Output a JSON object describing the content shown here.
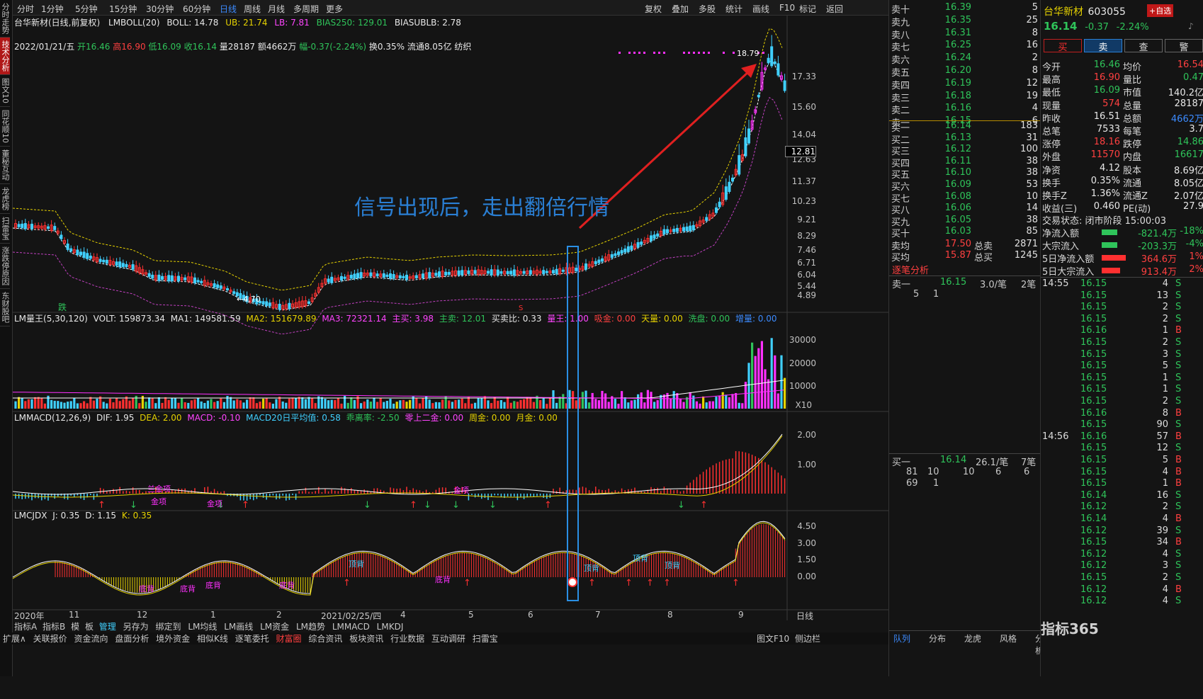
{
  "left_tabs": [
    "分时走势",
    "技术分析",
    "图文10",
    "同花顺10",
    "董秘互动",
    "龙虎榜",
    "扫雷宝",
    "涨跌停原因",
    "东财股吧"
  ],
  "toolbar": {
    "items": [
      "分时",
      "1分钟",
      "5分钟",
      "15分钟",
      "30分钟",
      "60分钟",
      "日线",
      "周线",
      "月线",
      "多周期",
      "更多"
    ],
    "active": "日线",
    "right_items": [
      "复权",
      "叠加",
      "多股",
      "统计",
      "画线",
      "F10",
      "标记",
      "返回"
    ]
  },
  "title": {
    "name": "台华新材(日线,前复权)",
    "indicator": "LMBOLL(20)",
    "boll": "BOLL: 14.78",
    "ub": "UB: 21.74",
    "lb": "LB: 7.81",
    "bias": "BIAS250: 129.01",
    "biasub": "BIASUBLB: 2.78"
  },
  "info": {
    "date": "2022/01/21/五",
    "open": "开16.46",
    "high": "高16.90",
    "low": "低16.09",
    "close": "收16.14",
    "vol": "量28187",
    "amt": "额4662万",
    "chg": "幅-0.37(-2.24%)",
    "turn": "换0.35%",
    "float": "流通8.05亿",
    "sector": "纺织"
  },
  "price_axis": [
    "17.33",
    "15.60",
    "14.04",
    "12.63",
    "11.37",
    "10.23",
    "9.21",
    "8.29",
    "7.46",
    "6.71",
    "6.04",
    "5.44",
    "4.89"
  ],
  "price_current": "12.81",
  "price_marks": {
    "high": "18.79",
    "low": "4.70"
  },
  "annotation": "信号出现后，走出翻倍行情",
  "signal_labels": {
    "fall": "跌",
    "s": "S"
  },
  "vol_header": {
    "name": "LM量王(5,30,120)",
    "volt": "VOLT: 159873.34",
    "ma1": "MA1: 149581.59",
    "ma2": "MA2: 151679.89",
    "ma3": "MA3: 72321.14",
    "buy": "主买: 3.98",
    "sell": "主卖: 12.01",
    "ratio": "买卖比: 0.33",
    "king": "量王: 1.00",
    "absorb": "吸金: 0.00",
    "sky": "天量: 0.00",
    "wash": "洗盘: 0.00",
    "extra": "增量: 0.00"
  },
  "vol_axis": [
    "30000",
    "20000",
    "10000"
  ],
  "vol_unit": "X10",
  "macd_header": {
    "name": "LMMACD(12,26,9)",
    "dif": "DIF: 1.95",
    "dea": "DEA: 2.00",
    "macd": "MACD: -0.10",
    "avg": "MACD20日平均值: 0.58",
    "dist": "乖离率: -2.50",
    "zero": "零上二金: 0.00",
    "week": "周金: 0.00",
    "month": "月金: 0.00"
  },
  "macd_axis": [
    "2.00",
    "1.00"
  ],
  "macd_labels": [
    "兰金项",
    "金项",
    "金项",
    "金项"
  ],
  "kdj_header": {
    "name": "LMCJDX",
    "j": "J: 0.35",
    "d": "D: 1.15",
    "k": "K: 0.35"
  },
  "kdj_axis": [
    "4.50",
    "3.00",
    "1.50",
    "0.00"
  ],
  "kdj_labels": [
    "顶背",
    "底背",
    "底背",
    "底背",
    "底背",
    "底背",
    "顶背",
    "顶背",
    "顶背"
  ],
  "date_axis": {
    "items": [
      "2020年",
      "11",
      "12",
      "1",
      "2",
      "2021/02/25/四",
      "4",
      "5",
      "6",
      "7",
      "8",
      "9"
    ],
    "right": "日线"
  },
  "bottom1": [
    "指标A",
    "指标B",
    "模",
    "板",
    "管理",
    "另存为",
    "绑定到",
    "LM均线",
    "LM画线",
    "LM资金",
    "LM趋势",
    "LMMACD",
    "LMKDJ"
  ],
  "bottom2": [
    "扩展∧",
    "关联报价",
    "资金流向",
    "盘面分析",
    "境外资金",
    "相似K线",
    "逐笔委托",
    "财富圈",
    "综合资讯",
    "板块资讯",
    "行业数据",
    "互动调研",
    "扫雷宝"
  ],
  "bottom2_right": [
    "图文F10",
    "侧边栏"
  ],
  "orderbook": {
    "asks": [
      {
        "label": "卖十",
        "price": "16.39",
        "vol": "5"
      },
      {
        "label": "卖九",
        "price": "16.35",
        "vol": "25"
      },
      {
        "label": "卖八",
        "price": "16.31",
        "vol": "8"
      },
      {
        "label": "卖七",
        "price": "16.25",
        "vol": "16"
      },
      {
        "label": "卖六",
        "price": "16.24",
        "vol": "2"
      },
      {
        "label": "卖五",
        "price": "16.20",
        "vol": "8"
      },
      {
        "label": "卖四",
        "price": "16.19",
        "vol": "12"
      },
      {
        "label": "卖三",
        "price": "16.18",
        "vol": "19"
      },
      {
        "label": "卖二",
        "price": "16.16",
        "vol": "4"
      },
      {
        "label": "卖一",
        "price": "16.15",
        "vol": "6"
      }
    ],
    "bids": [
      {
        "label": "买一",
        "price": "16.14",
        "vol": "183"
      },
      {
        "label": "买二",
        "price": "16.13",
        "vol": "31"
      },
      {
        "label": "买三",
        "price": "16.12",
        "vol": "100"
      },
      {
        "label": "买四",
        "price": "16.11",
        "vol": "38"
      },
      {
        "label": "买五",
        "price": "16.10",
        "vol": "38"
      },
      {
        "label": "买六",
        "price": "16.09",
        "vol": "53"
      },
      {
        "label": "买七",
        "price": "16.08",
        "vol": "10"
      },
      {
        "label": "买八",
        "price": "16.06",
        "vol": "14"
      },
      {
        "label": "买九",
        "price": "16.05",
        "vol": "38"
      },
      {
        "label": "买十",
        "price": "16.03",
        "vol": "85"
      }
    ],
    "avg_sell": {
      "label": "卖均",
      "price": "17.50",
      "k": "总卖",
      "v": "2871"
    },
    "avg_buy": {
      "label": "买均",
      "price": "15.87",
      "k": "总买",
      "v": "1245"
    },
    "section": "逐笔分析",
    "sell1": {
      "label": "卖一",
      "price": "16.15",
      "per": "3.0/笔",
      "count": "2笔",
      "d1": "5",
      "d2": "1"
    },
    "buy1": {
      "label": "买一",
      "price": "16.14",
      "per": "26.1/笔",
      "count": "7笔",
      "row1": [
        "81",
        "10",
        "10",
        "6",
        "6"
      ],
      "row2": [
        "69",
        "1"
      ]
    },
    "tabs": [
      "队列",
      "分布",
      "龙虎",
      "风格",
      "分析"
    ]
  },
  "stock": {
    "name": "台华新材",
    "code": "603055",
    "price": "16.14",
    "chg": "-0.37",
    "pct": "-2.24%",
    "btn_add": "+自选",
    "buttons": [
      "买",
      "卖",
      "查",
      "警"
    ],
    "rows": [
      [
        "今开",
        "16.46",
        "均价",
        "16.54"
      ],
      [
        "最高",
        "16.90",
        "量比",
        "0.47"
      ],
      [
        "最低",
        "16.09",
        "市值",
        "140.2亿"
      ],
      [
        "现量",
        "574",
        "总量",
        "28187"
      ],
      [
        "昨收",
        "16.51",
        "总额",
        "4662万"
      ],
      [
        "总笔",
        "7533",
        "每笔",
        "3.7"
      ],
      [
        "涨停",
        "18.16",
        "跌停",
        "14.86"
      ],
      [
        "外盘",
        "11570",
        "内盘",
        "16617"
      ],
      [
        "净资",
        "4.12",
        "股本",
        "8.69亿"
      ],
      [
        "换手",
        "0.35%",
        "流通",
        "8.05亿"
      ],
      [
        "换手Z",
        "1.36%",
        "流通Z",
        "2.07亿"
      ],
      [
        "收益(三)",
        "0.460",
        "PE(动)",
        "27.9"
      ]
    ],
    "status": "交易状态: 闭市阶段 15:00:03",
    "flows": [
      {
        "k": "净流入额",
        "v": "-821.4万",
        "p": "-18%"
      },
      {
        "k": "大宗流入",
        "v": "-203.3万",
        "p": "-4%"
      },
      {
        "k": "5日净流入额",
        "v": "364.6万",
        "p": "1%"
      },
      {
        "k": "5日大宗流入",
        "v": "913.4万",
        "p": "2%"
      }
    ],
    "ticks": [
      [
        "14:55",
        "16.15",
        "4",
        "S"
      ],
      [
        "",
        "16.15",
        "13",
        "S"
      ],
      [
        "",
        "16.15",
        "2",
        "S"
      ],
      [
        "",
        "16.15",
        "2",
        "S"
      ],
      [
        "",
        "16.16",
        "1",
        "B"
      ],
      [
        "",
        "16.15",
        "2",
        "S"
      ],
      [
        "",
        "16.15",
        "3",
        "S"
      ],
      [
        "",
        "16.15",
        "5",
        "S"
      ],
      [
        "",
        "16.15",
        "1",
        "S"
      ],
      [
        "",
        "16.15",
        "1",
        "S"
      ],
      [
        "",
        "16.15",
        "2",
        "S"
      ],
      [
        "",
        "16.16",
        "8",
        "B"
      ],
      [
        "",
        "16.15",
        "90",
        "S"
      ],
      [
        "14:56",
        "16.16",
        "57",
        "B"
      ],
      [
        "",
        "16.15",
        "12",
        "S"
      ],
      [
        "",
        "16.15",
        "5",
        "B"
      ],
      [
        "",
        "16.15",
        "4",
        "B"
      ],
      [
        "",
        "16.15",
        "1",
        "B"
      ],
      [
        "",
        "16.14",
        "16",
        "S"
      ],
      [
        "",
        "16.12",
        "2",
        "S"
      ],
      [
        "",
        "16.14",
        "4",
        "B"
      ],
      [
        "",
        "16.12",
        "39",
        "S"
      ],
      [
        "",
        "16.15",
        "34",
        "B"
      ],
      [
        "",
        "16.12",
        "4",
        "S"
      ],
      [
        "",
        "16.12",
        "3",
        "S"
      ],
      [
        "",
        "16.15",
        "2",
        "S"
      ],
      [
        "",
        "16.12",
        "4",
        "B"
      ],
      [
        "",
        "16.12",
        "4",
        "S"
      ]
    ],
    "watermark": "指标365"
  }
}
